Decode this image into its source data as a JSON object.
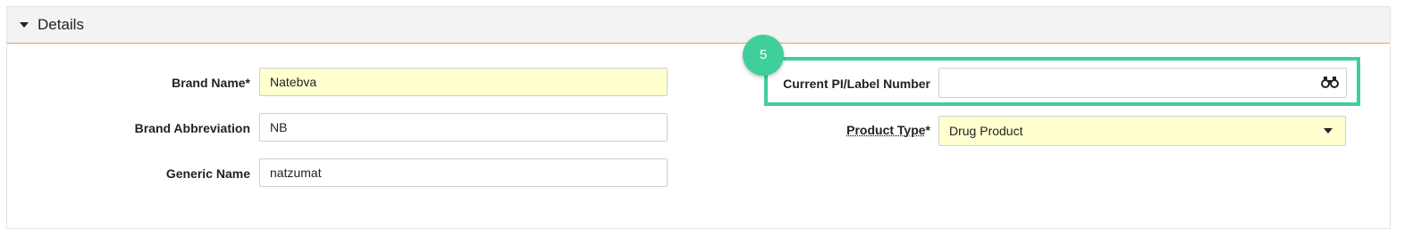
{
  "panel": {
    "title": "Details",
    "toggle_icon": "caret-down-icon"
  },
  "fields": {
    "brand_name": {
      "label": "Brand Name*",
      "value": "Natebva",
      "required": true
    },
    "brand_abbreviation": {
      "label": "Brand Abbreviation",
      "value": "NB"
    },
    "generic_name": {
      "label": "Generic Name",
      "value": "natzumat"
    },
    "current_pi_label_number": {
      "label": "Current PI/Label Number",
      "value": "",
      "lookup_icon": "binoculars-icon"
    },
    "product_type": {
      "label": "Product Type*",
      "label_text": "Product Type",
      "label_suffix": "*",
      "value": "Drug Product",
      "required": true,
      "dropdown_icon": "chevron-down-icon"
    }
  },
  "annotation": {
    "step_number": "5",
    "highlight_color": "#3fcf9a"
  },
  "colors": {
    "required_field_bg": "#ffffd0",
    "header_border_accent": "#f0a055",
    "header_bg": "#f3f3f3"
  }
}
